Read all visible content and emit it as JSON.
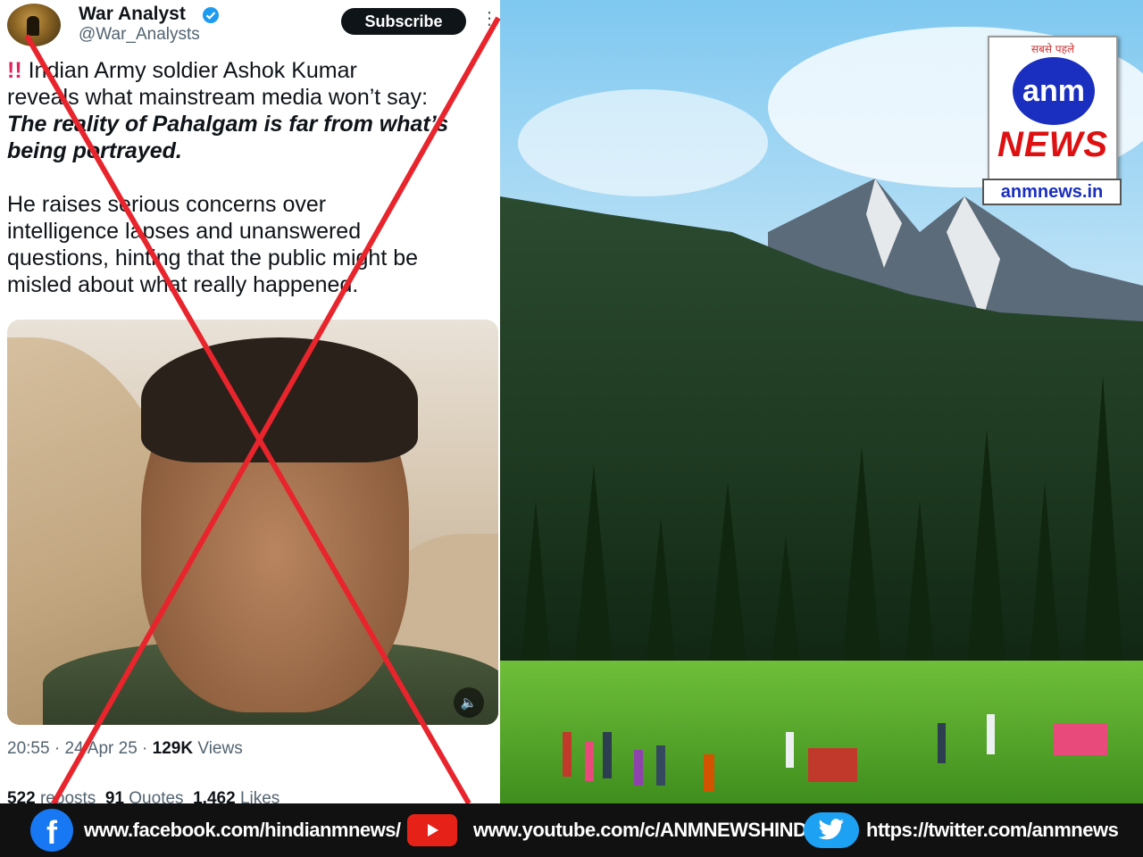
{
  "tweet": {
    "author_name": "War Analyst",
    "handle": "@War_Analysts",
    "subscribe_label": "Subscribe",
    "alert_icon": "!!",
    "line1": "Indian Army soldier Ashok Kumar",
    "line2": "reveals what mainstream media won’t say:",
    "line3": "The reality of Pahalgam is far from what’s",
    "line4": "being portrayed.",
    "line5": "He raises serious concerns over",
    "line6": "intelligence lapses and unanswered",
    "line7": "questions, hinting that the public might be",
    "line8": "misled about what really happened.",
    "time": "20:55",
    "date": "24 Apr 25",
    "views": "129K",
    "views_label": "Views",
    "reposts": "522",
    "reposts_label": "reposts",
    "quotes": "91",
    "quotes_label": "Quotes",
    "likes": "1,462",
    "likes_label": "Likes"
  },
  "logo": {
    "tagline": "सबसे पहले",
    "brand": "anm",
    "news": "NEWS",
    "url": "anmnews.in"
  },
  "social": {
    "facebook": "www.facebook.com/hindianmnews/",
    "youtube": "www.youtube.com/c/ANMNEWSHINDI",
    "twitter": "https://twitter.com/anmnews"
  },
  "colors": {
    "cross": "#e8242c",
    "facebook": "#1877f2",
    "youtube": "#e62117",
    "twitter": "#1da1f2",
    "logo_blue": "#1a2fbf",
    "logo_red": "#d11111"
  }
}
